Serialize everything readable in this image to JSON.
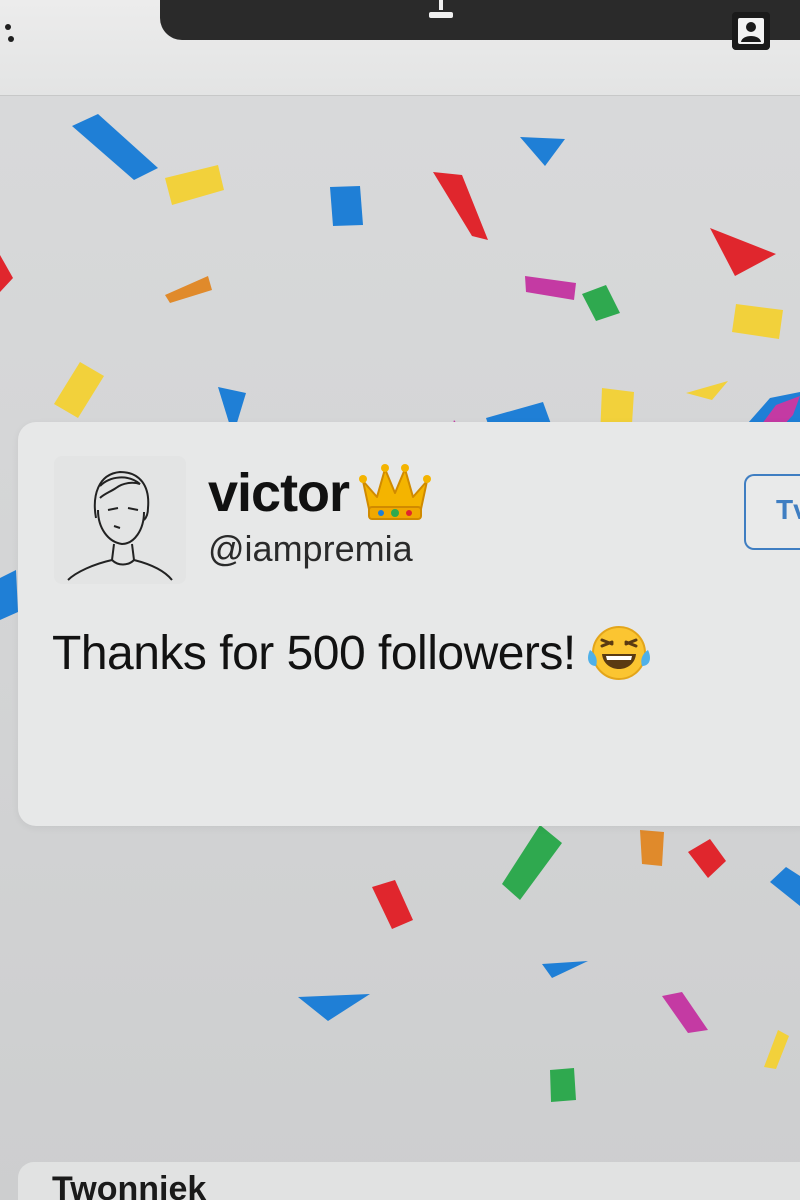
{
  "tweet": {
    "display_name": "victor",
    "name_badge_icon": "crown-emoji",
    "handle": "@iampremia",
    "text": "Thanks for 500 followers!",
    "text_emoji_icon": "face-with-tears-of-joy-emoji",
    "follow_button_label": "Tv"
  },
  "header": {
    "icons": [
      "more-dots-icon",
      "lamp-icon",
      "profile-icon"
    ]
  },
  "bottom_section": {
    "title": "Twonniek"
  },
  "colors": {
    "background": "#d8d9da",
    "card": "#e7e8e8",
    "accent": "#3f7ec2",
    "confetti": [
      "#1f7fd6",
      "#f2d13b",
      "#e0262d",
      "#2fa94f",
      "#c43aa3",
      "#e08a2b"
    ]
  }
}
